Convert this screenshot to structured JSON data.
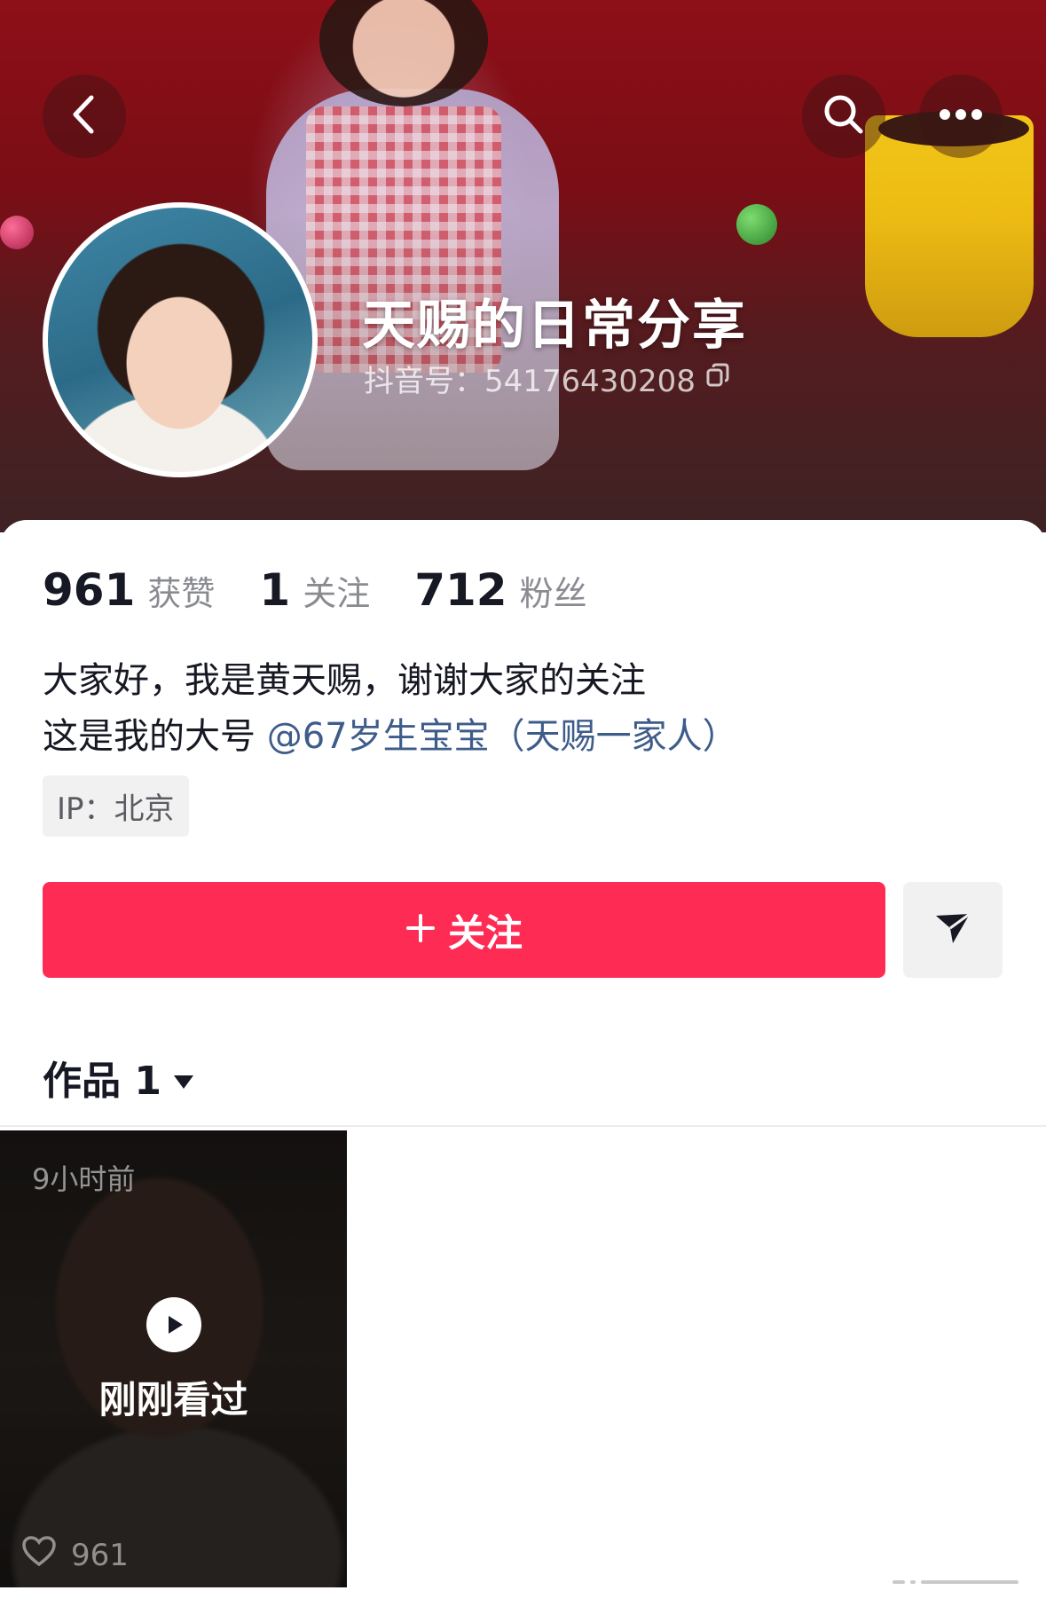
{
  "profile": {
    "nickname": "天赐的日常分享",
    "douyin_id": "抖音号：54176430208"
  },
  "header": {
    "back_icon": "chevron-left-icon",
    "search_icon": "search-icon",
    "more_icon": "more-horizontal-icon"
  },
  "stats": {
    "likes_count": "961",
    "likes_label": "获赞",
    "following_count": "1",
    "following_label": "关注",
    "followers_count": "712",
    "followers_label": "粉丝"
  },
  "bio": {
    "line1": "大家好，我是黄天赐，谢谢大家的关注",
    "line2_prefix": "这是我的大号",
    "line2_mention": "@67岁生宝宝（天赐一家人）"
  },
  "ip_location": "IP：北京",
  "actions": {
    "follow_label": "关注",
    "follow_icon": "plus-icon",
    "message_icon": "send-icon"
  },
  "works_tab": {
    "label": "作品 1"
  },
  "videos": [
    {
      "time": "9小时前",
      "watched_label": "刚刚看过",
      "likes": "961"
    }
  ],
  "colors": {
    "accent": "#fe2c55",
    "mention": "#3e5c8a",
    "text_primary": "#161823",
    "text_secondary": "#8a8b91"
  }
}
